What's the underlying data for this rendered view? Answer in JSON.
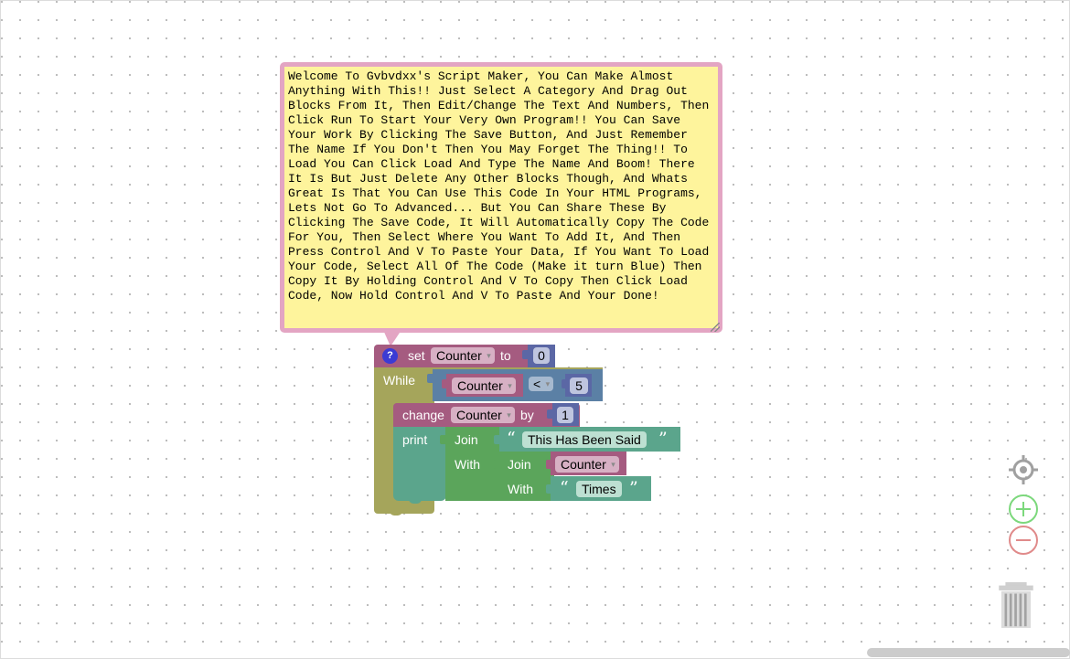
{
  "comment": {
    "text": "Welcome To Gvbvdxx's Script Maker, You Can Make Almost Anything With This!! Just Select A Category And Drag Out Blocks From It, Then Edit/Change The Text And Numbers, Then Click Run To Start Your Very Own Program!! You Can Save Your Work By Clicking The Save Button, And Just Remember The Name If You Don't Then You May Forget The Thing!! To Load You Can Click Load And Type The Name And Boom! There It Is But Just Delete Any Other Blocks Though, And Whats Great Is That You Can Use This Code In Your HTML Programs, Lets Not Go To Advanced... But You Can Share These By Clicking The Save Code, It Will Automatically Copy The Code For You, Then Select Where You Want To Add It, And Then Press Control And V To Paste Your Data, If You Want To Load Your Code, Select All Of The Code (Make it turn Blue) Then Copy It By Holding Control And V To Copy Then Click Load Code, Now Hold Control And V To Paste And Your Done!"
  },
  "blocks": {
    "set": {
      "help_icon": "?",
      "label": "set",
      "variable": "Counter",
      "to_label": "to",
      "value": "0"
    },
    "while": {
      "label": "While",
      "compare_variable": "Counter",
      "operator": "<",
      "compare_value": "5"
    },
    "change": {
      "label": "change",
      "variable": "Counter",
      "by_label": "by",
      "value": "1"
    },
    "print": {
      "label": "print",
      "join_label": "Join",
      "with_label": "With",
      "text1": "This Has Been Said",
      "inner_join_label": "Join",
      "inner_variable": "Counter",
      "inner_with_label": "With",
      "text2": "Times"
    }
  },
  "controls": {
    "recenter": "target-icon",
    "zoom_in": "plus-icon",
    "zoom_out": "minus-icon",
    "trash": "trash-icon"
  },
  "colors": {
    "variables": "#a55b80",
    "loop": "#a5a55b",
    "logic": "#5b80a5",
    "math": "#5b67a5",
    "text": "#5ba58c",
    "lists": "#5ba55b",
    "comment_fill": "#fef49c",
    "comment_border": "#e3a5c3"
  }
}
